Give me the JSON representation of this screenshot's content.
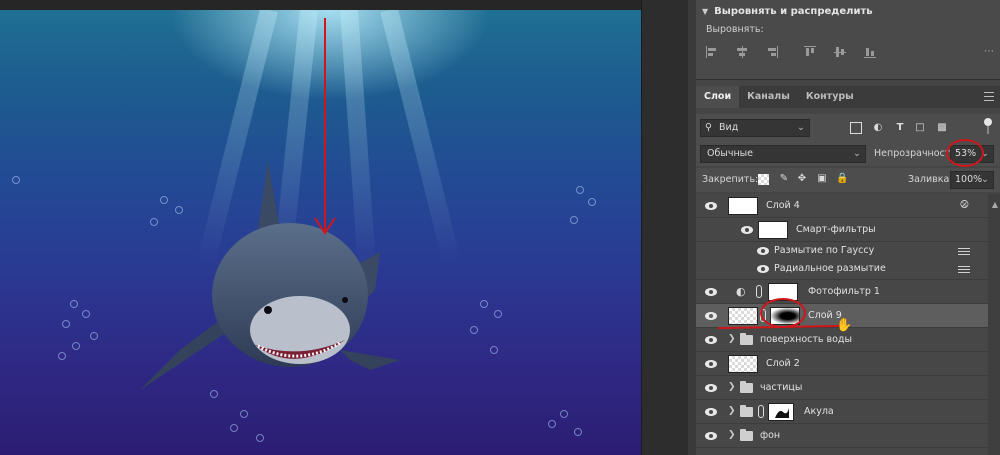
{
  "align_panel": {
    "title": "Выровнять и распределить",
    "align_label": "Выровнять:"
  },
  "layers_panel": {
    "tabs": [
      {
        "label": "Слои",
        "active": true
      },
      {
        "label": "Каналы",
        "active": false
      },
      {
        "label": "Контуры",
        "active": false
      }
    ],
    "filter_select": "Вид",
    "blend_mode": "Обычные",
    "opacity_label": "Непрозрачность:",
    "opacity_value": "53%",
    "lock_label": "Закрепить:",
    "fill_label": "Заливка:",
    "fill_value": "100%",
    "layers": [
      {
        "name": "Слой 4",
        "type": "smart-object"
      },
      {
        "name": "Смарт-фильтры",
        "type": "smart-filters"
      },
      {
        "name": "Размытие по Гауссу",
        "type": "filter"
      },
      {
        "name": "Радиальное размытие",
        "type": "filter"
      },
      {
        "name": "Фотофильтр 1",
        "type": "adjustment"
      },
      {
        "name": "Слой 9",
        "type": "masked",
        "selected": true
      },
      {
        "name": "поверхность воды",
        "type": "group"
      },
      {
        "name": "Слой 2",
        "type": "pixel"
      },
      {
        "name": "частицы",
        "type": "group"
      },
      {
        "name": "Акула",
        "type": "group-masked"
      },
      {
        "name": "фон",
        "type": "group"
      }
    ]
  },
  "colors": {
    "annotation_red": "#d0161b",
    "panel_bg": "#454545",
    "selected_row": "#5e5e5e"
  }
}
